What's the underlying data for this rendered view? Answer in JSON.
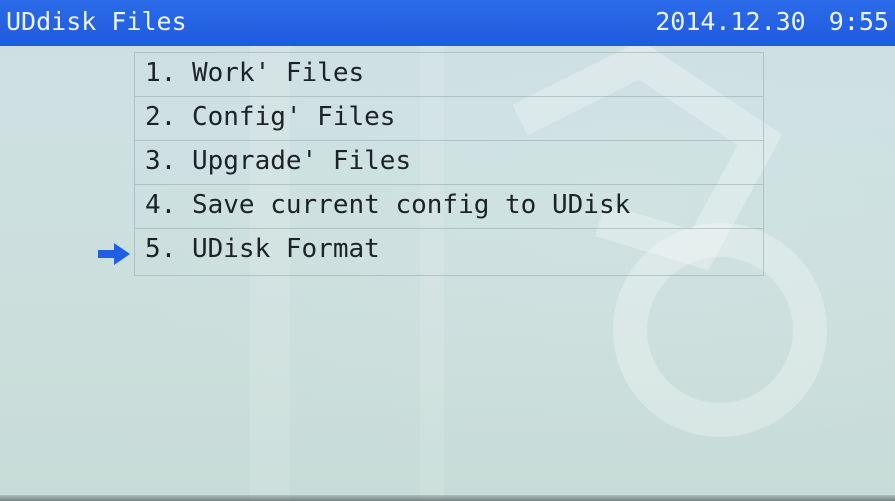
{
  "header": {
    "title": "UDdisk Files",
    "date_time": "2014.12.30  9:55"
  },
  "menu": {
    "items": [
      {
        "label": "1. Work' Files"
      },
      {
        "label": "2. Config' Files"
      },
      {
        "label": "3. Upgrade' Files"
      },
      {
        "label": "4. Save current config to UDisk"
      },
      {
        "label": "5. UDisk Format"
      }
    ],
    "selected_index": 4
  },
  "colors": {
    "title_bar": "#2360e4",
    "selection_arrow": "#1f5fe6",
    "screen_background": "#cddfe0"
  },
  "icons": {
    "selection": "right-arrow-icon"
  }
}
